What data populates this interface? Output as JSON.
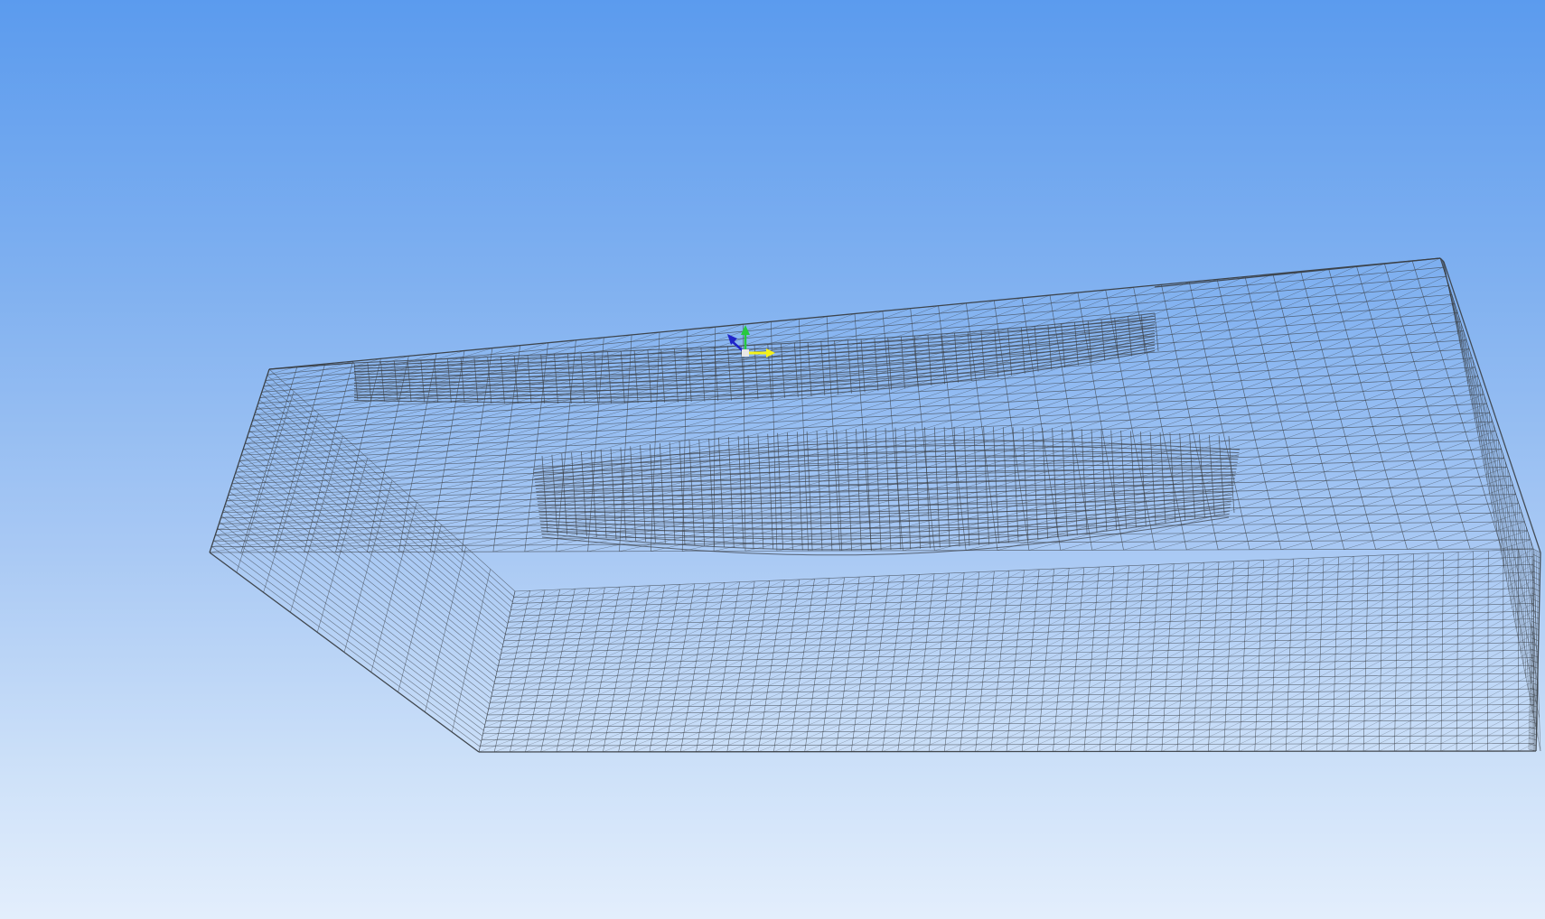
{
  "viewport": {
    "background_top": "#5b9bee",
    "background_bottom": "#e3eefc",
    "mesh_color": "#3a3f45"
  },
  "axis_triad": {
    "x_color": "#f5f11a",
    "y_color": "#27c93f",
    "z_color": "#1f23c9",
    "icon": "axis-triad-icon"
  },
  "mesh": {
    "style": "wireframe",
    "features": [
      "channel-upper",
      "channel-lower-hull"
    ]
  }
}
